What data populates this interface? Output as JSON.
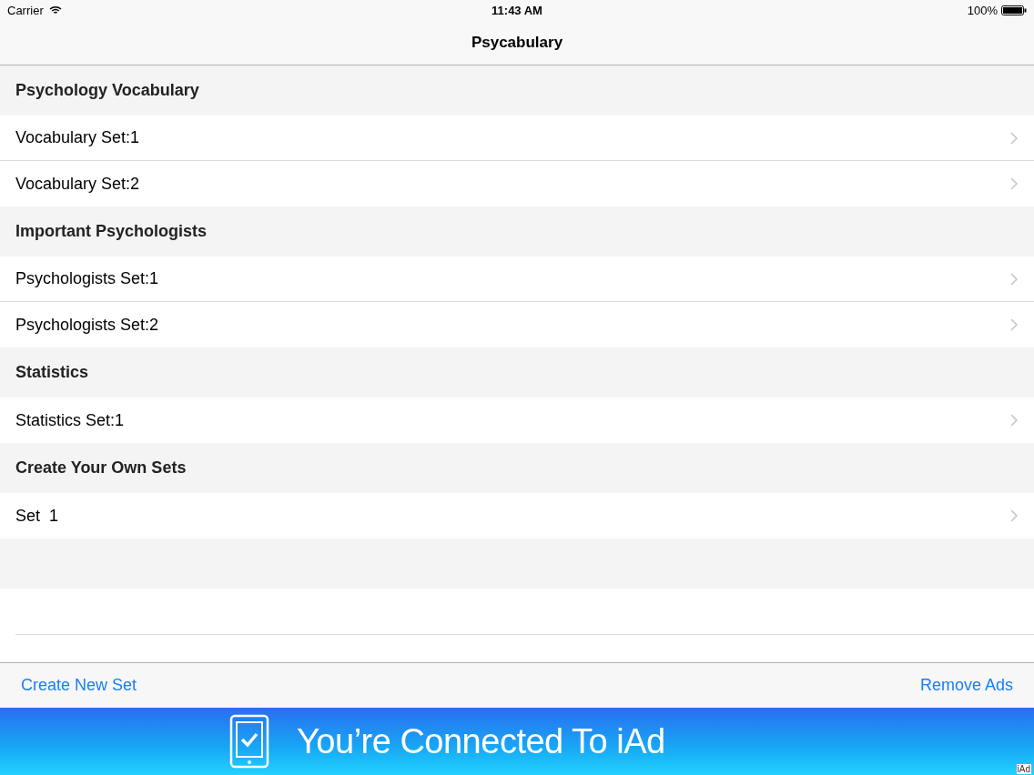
{
  "status_bar": {
    "carrier": "Carrier",
    "time": "11:43 AM",
    "battery": "100%"
  },
  "nav": {
    "title": "Psycabulary"
  },
  "sections": [
    {
      "title": "Psychology Vocabulary",
      "rows": [
        {
          "label": "Vocabulary Set:1"
        },
        {
          "label": "Vocabulary Set:2"
        }
      ]
    },
    {
      "title": "Important Psychologists",
      "rows": [
        {
          "label": "Psychologists Set:1"
        },
        {
          "label": "Psychologists Set:2"
        }
      ]
    },
    {
      "title": "Statistics",
      "rows": [
        {
          "label": "Statistics Set:1"
        }
      ]
    },
    {
      "title": "Create Your Own Sets",
      "rows": [
        {
          "label": "Set  1"
        }
      ]
    }
  ],
  "toolbar": {
    "left": "Create New Set",
    "right": "Remove Ads"
  },
  "ad_banner": {
    "text": "You’re Connected To iAd",
    "corner_label": "iAd"
  }
}
